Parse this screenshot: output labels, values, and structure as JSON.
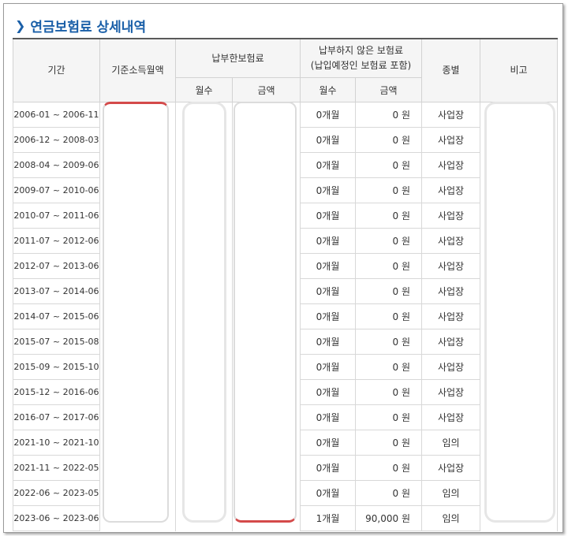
{
  "title": "연금보험료 상세내역",
  "headers": {
    "period": "기간",
    "base_income": "기준소득월액",
    "paid_group": "납부한보험료",
    "unpaid_group_line1": "납부하지 않은 보험료",
    "unpaid_group_line2": "(납입예정인 보험료 포함)",
    "type": "종별",
    "note": "비고",
    "months": "월수",
    "amount": "금액"
  },
  "rows": [
    {
      "period": "2006-01 ~ 2006-11",
      "unpaid_months": "0개월",
      "unpaid_amount": "0 원",
      "type": "사업장"
    },
    {
      "period": "2006-12 ~ 2008-03",
      "unpaid_months": "0개월",
      "unpaid_amount": "0 원",
      "type": "사업장"
    },
    {
      "period": "2008-04 ~ 2009-06",
      "unpaid_months": "0개월",
      "unpaid_amount": "0 원",
      "type": "사업장"
    },
    {
      "period": "2009-07 ~ 2010-06",
      "unpaid_months": "0개월",
      "unpaid_amount": "0 원",
      "type": "사업장"
    },
    {
      "period": "2010-07 ~ 2011-06",
      "unpaid_months": "0개월",
      "unpaid_amount": "0 원",
      "type": "사업장"
    },
    {
      "period": "2011-07 ~ 2012-06",
      "unpaid_months": "0개월",
      "unpaid_amount": "0 원",
      "type": "사업장"
    },
    {
      "period": "2012-07 ~ 2013-06",
      "unpaid_months": "0개월",
      "unpaid_amount": "0 원",
      "type": "사업장"
    },
    {
      "period": "2013-07 ~ 2014-06",
      "unpaid_months": "0개월",
      "unpaid_amount": "0 원",
      "type": "사업장"
    },
    {
      "period": "2014-07 ~ 2015-06",
      "unpaid_months": "0개월",
      "unpaid_amount": "0 원",
      "type": "사업장"
    },
    {
      "period": "2015-07 ~ 2015-08",
      "unpaid_months": "0개월",
      "unpaid_amount": "0 원",
      "type": "사업장"
    },
    {
      "period": "2015-09 ~ 2015-10",
      "unpaid_months": "0개월",
      "unpaid_amount": "0 원",
      "type": "사업장"
    },
    {
      "period": "2015-12 ~ 2016-06",
      "unpaid_months": "0개월",
      "unpaid_amount": "0 원",
      "type": "사업장"
    },
    {
      "period": "2016-07 ~ 2017-06",
      "unpaid_months": "0개월",
      "unpaid_amount": "0 원",
      "type": "사업장"
    },
    {
      "period": "2021-10 ~ 2021-10",
      "unpaid_months": "0개월",
      "unpaid_amount": "0 원",
      "type": "임의"
    },
    {
      "period": "2021-11 ~ 2022-05",
      "unpaid_months": "0개월",
      "unpaid_amount": "0 원",
      "type": "사업장"
    },
    {
      "period": "2022-06 ~ 2023-05",
      "unpaid_months": "0개월",
      "unpaid_amount": "0 원",
      "type": "임의"
    },
    {
      "period": "2023-06 ~ 2023-06",
      "unpaid_months": "1개월",
      "unpaid_amount": "90,000 원",
      "type": "임의"
    }
  ]
}
